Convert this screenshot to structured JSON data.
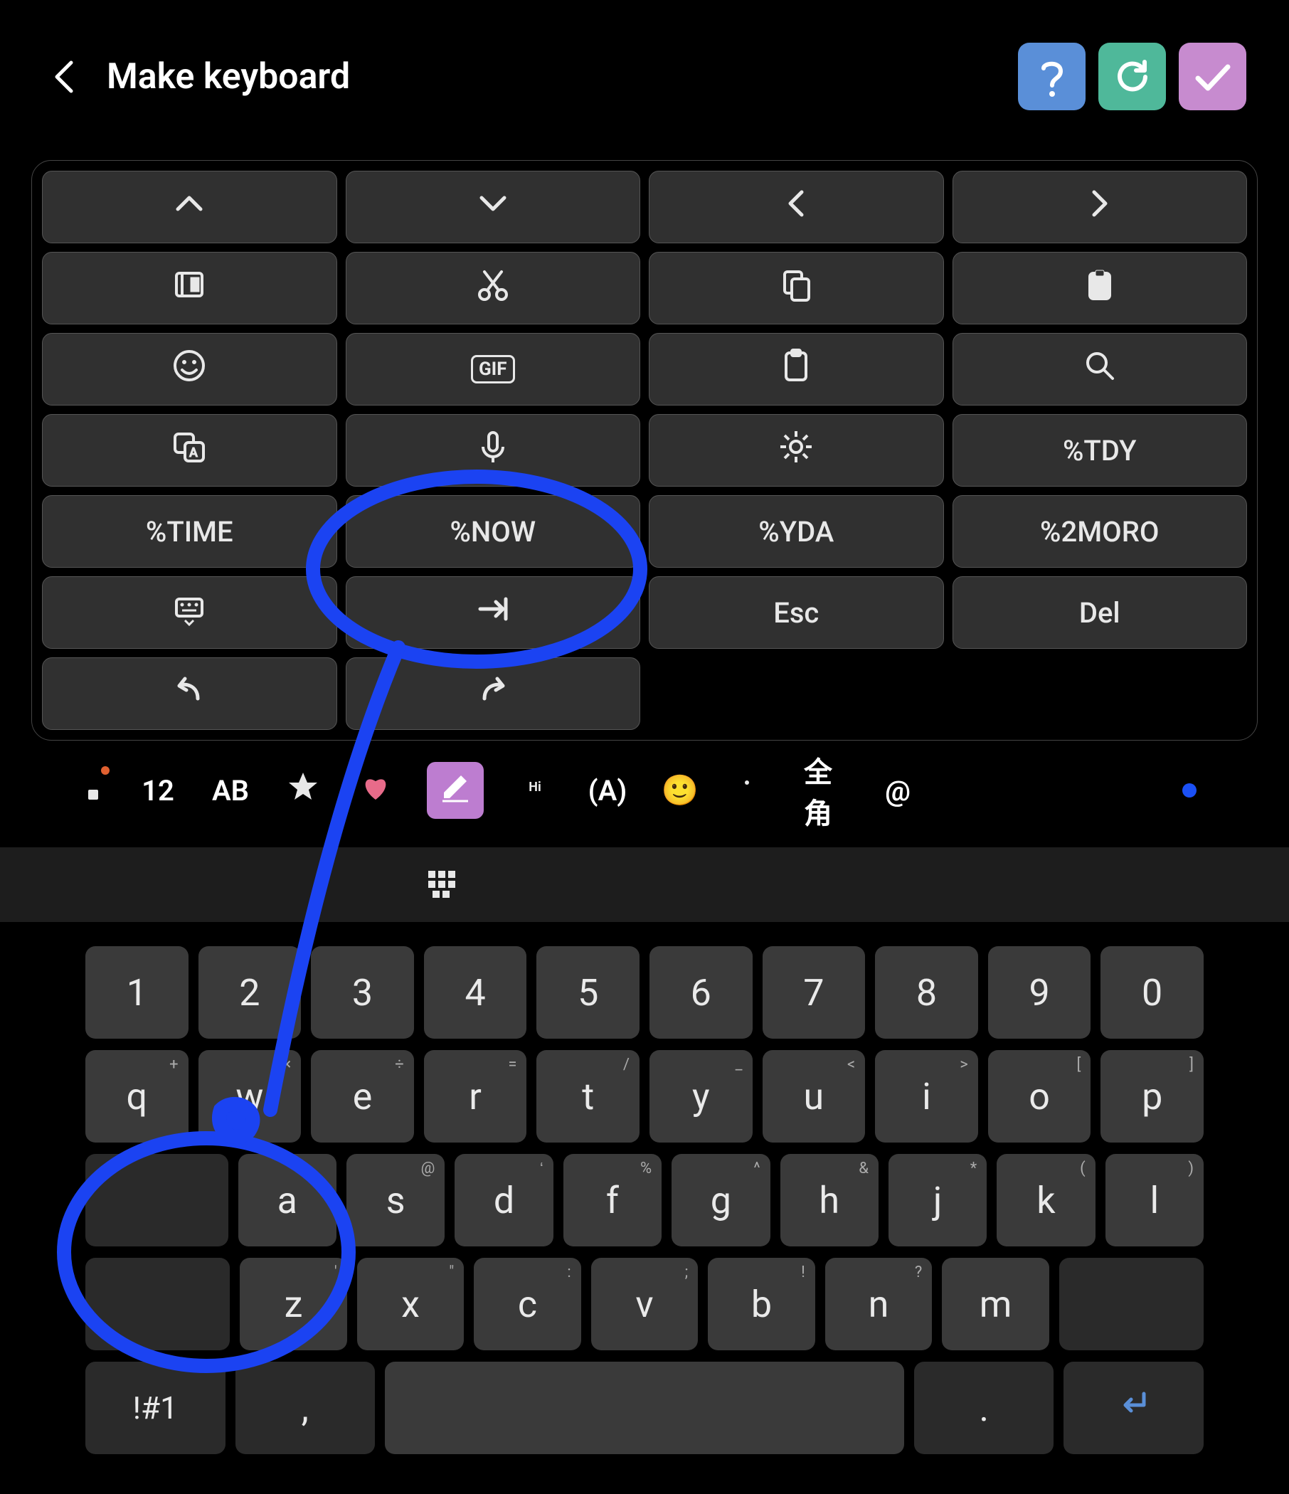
{
  "header": {
    "title": "Make keyboard"
  },
  "panel_keys": [
    {
      "id": "arrow-up",
      "type": "icon"
    },
    {
      "id": "arrow-down",
      "type": "icon"
    },
    {
      "id": "arrow-left",
      "type": "icon"
    },
    {
      "id": "arrow-right",
      "type": "icon"
    },
    {
      "id": "select-text",
      "type": "icon"
    },
    {
      "id": "cut",
      "type": "icon"
    },
    {
      "id": "copy",
      "type": "icon"
    },
    {
      "id": "paste",
      "type": "icon"
    },
    {
      "id": "emoji",
      "type": "icon"
    },
    {
      "id": "gif",
      "type": "text",
      "label": "GIF"
    },
    {
      "id": "clipboard",
      "type": "icon"
    },
    {
      "id": "search",
      "type": "icon"
    },
    {
      "id": "translate",
      "type": "icon"
    },
    {
      "id": "voice",
      "type": "icon"
    },
    {
      "id": "settings",
      "type": "icon"
    },
    {
      "id": "tdy",
      "type": "text",
      "label": "%TDY"
    },
    {
      "id": "time",
      "type": "text",
      "label": "%TIME"
    },
    {
      "id": "now",
      "type": "text",
      "label": "%NOW"
    },
    {
      "id": "yda",
      "type": "text",
      "label": "%YDA"
    },
    {
      "id": "2moro",
      "type": "text",
      "label": "%2MORO"
    },
    {
      "id": "keyboard-mode",
      "type": "icon"
    },
    {
      "id": "tab",
      "type": "icon"
    },
    {
      "id": "esc",
      "type": "text",
      "label": "Esc"
    },
    {
      "id": "del",
      "type": "text",
      "label": "Del"
    }
  ],
  "panel_last_row": [
    {
      "id": "undo",
      "type": "icon"
    },
    {
      "id": "redo",
      "type": "icon"
    }
  ],
  "toolbar": {
    "items": [
      {
        "id": "apps",
        "badge": true
      },
      {
        "id": "size",
        "label": "12"
      },
      {
        "id": "case",
        "label": "AB"
      },
      {
        "id": "star"
      },
      {
        "id": "heart"
      },
      {
        "id": "edit",
        "active": true
      },
      {
        "id": "hi"
      },
      {
        "id": "paren",
        "label": "(A)"
      },
      {
        "id": "smiley"
      },
      {
        "id": "image"
      },
      {
        "id": "fullwidth",
        "label": "全角"
      },
      {
        "id": "at",
        "label": "@"
      }
    ]
  },
  "kb_topbar": [
    {
      "id": "undo"
    },
    {
      "id": "redo",
      "disabled": true
    },
    {
      "id": "lock",
      "disabled": true
    },
    {
      "id": "delete",
      "disabled": true
    },
    {
      "id": "sync"
    },
    {
      "id": "grid"
    }
  ],
  "keyboard": {
    "row1": [
      "1",
      "2",
      "3",
      "4",
      "5",
      "6",
      "7",
      "8",
      "9",
      "0"
    ],
    "row2": [
      {
        "k": "q",
        "s": "+"
      },
      {
        "k": "w",
        "s": "×"
      },
      {
        "k": "e",
        "s": "÷"
      },
      {
        "k": "r",
        "s": "="
      },
      {
        "k": "t",
        "s": "/"
      },
      {
        "k": "y",
        "s": "_"
      },
      {
        "k": "u",
        "s": "<"
      },
      {
        "k": "i",
        "s": ">"
      },
      {
        "k": "o",
        "s": "["
      },
      {
        "k": "p",
        "s": "]"
      }
    ],
    "row3": [
      {
        "k": "a",
        "s": ""
      },
      {
        "k": "s",
        "s": "@"
      },
      {
        "k": "d",
        "s": "ʻ"
      },
      {
        "k": "f",
        "s": "%"
      },
      {
        "k": "g",
        "s": "^"
      },
      {
        "k": "h",
        "s": "&"
      },
      {
        "k": "j",
        "s": "*"
      },
      {
        "k": "k",
        "s": "("
      },
      {
        "k": "l",
        "s": ")"
      }
    ],
    "row4": [
      {
        "k": "z",
        "s": "'"
      },
      {
        "k": "x",
        "s": "\""
      },
      {
        "k": "c",
        "s": ":"
      },
      {
        "k": "v",
        "s": ";"
      },
      {
        "k": "b",
        "s": "!"
      },
      {
        "k": "n",
        "s": "?"
      },
      {
        "k": "m",
        "s": ""
      }
    ],
    "mode_key": "!#1",
    "comma": ",",
    "period": "."
  }
}
